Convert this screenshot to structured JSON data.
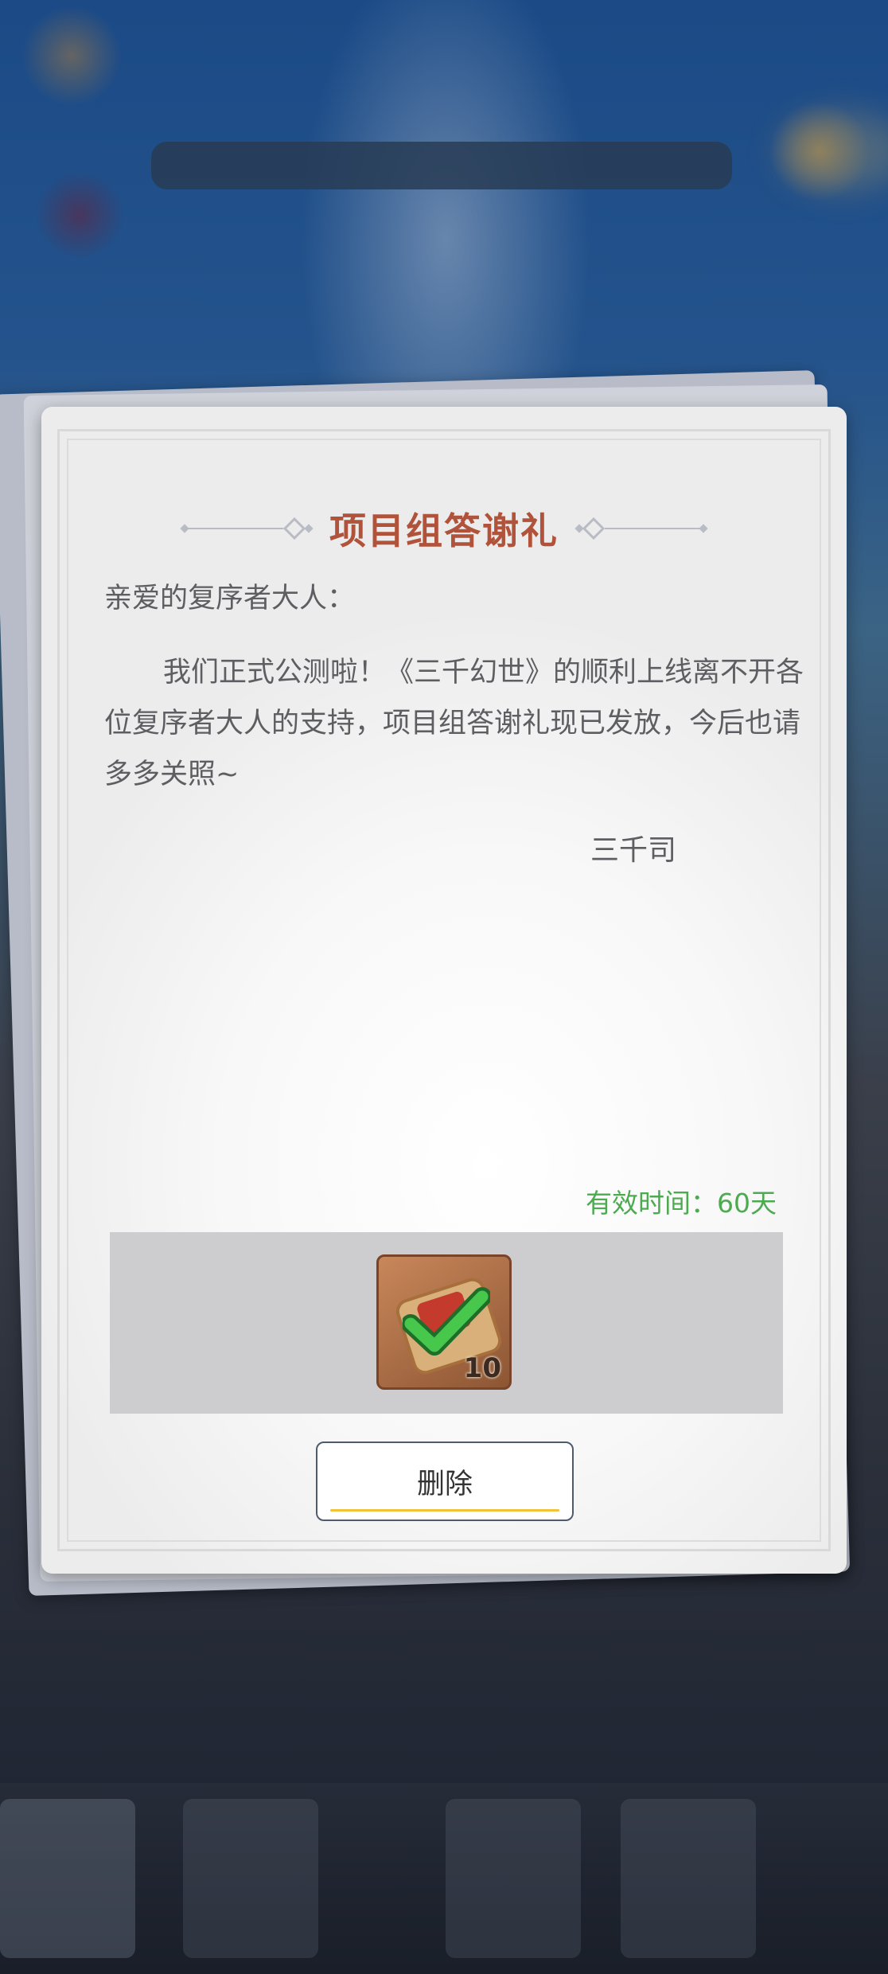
{
  "letter": {
    "title": "项目组答谢礼",
    "greeting": "亲爱的复序者大人：",
    "body": "我们正式公测啦！《三千幻世》的顺利上线离不开各位复序者大人的支持，项目组答谢礼现已发放，今后也请多多关照~",
    "signature": "三千司",
    "validity_label": "有效时间：",
    "validity_value": "60天"
  },
  "reward": {
    "item_icon": "scroll-reward-icon",
    "claimed_icon": "checkmark-icon",
    "quantity": "10"
  },
  "actions": {
    "delete_label": "删除"
  },
  "colors": {
    "title": "#b0533a",
    "validity": "#4caa4f",
    "button_accent": "#f2c23b"
  }
}
